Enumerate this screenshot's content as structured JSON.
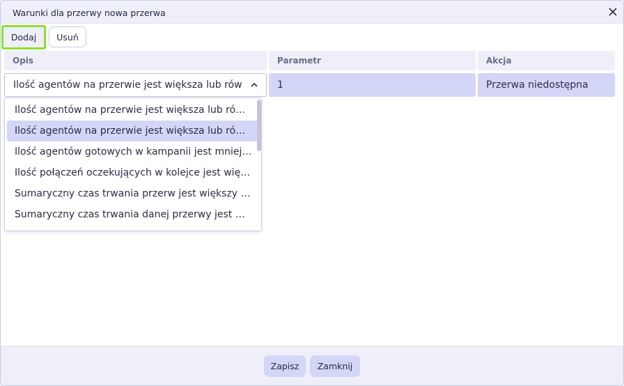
{
  "dialog": {
    "title": "Warunki dla przerwy nowa przerwa",
    "close_icon": "close-icon"
  },
  "toolbar": {
    "add_label": "Dodaj",
    "remove_label": "Usuń"
  },
  "table": {
    "headers": [
      "Opis",
      "Parametr",
      "Akcja"
    ],
    "row": {
      "opis": "Ilość agentów na przerwie jest większa lub rów",
      "parametr": "1",
      "akcja": "Przerwa niedostępna"
    }
  },
  "dropdown": {
    "selected_index": 1,
    "options": [
      "Ilość agentów na przerwie jest większa lub równa",
      "Ilość agentów na przerwie jest większa lub równa",
      "Ilość agentów gotowych w kampanii jest mniejsza",
      "Ilość połączeń oczekujących w kolejce jest większa",
      "Sumaryczny czas trwania przerw jest większy bądź",
      "Sumaryczny czas trwania danej przerwy jest większy"
    ]
  },
  "footer": {
    "save_label": "Zapisz",
    "close_label": "Zamknij"
  },
  "colors": {
    "accent": "#d4d6f7",
    "highlight_border": "#8fe02d",
    "panel_bg": "#eeeff8"
  }
}
